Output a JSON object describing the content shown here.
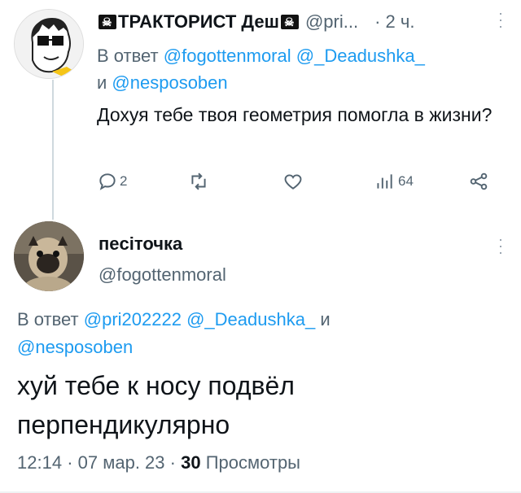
{
  "tweet1": {
    "display_name": "ТРАКТОРИСТ Деш",
    "handle": "@pri...",
    "separator": "·",
    "time": "2 ч.",
    "reply_prefix": "В ответ",
    "reply_mentions": [
      "@fogottenmoral",
      "@_Deadushka_",
      "@nesposoben"
    ],
    "reply_and": "и",
    "text": "Дохуя тебе твоя геометрия помогла в жизни?",
    "actions": {
      "replies": "2",
      "retweets": "",
      "likes": "",
      "views": "64"
    }
  },
  "tweet2": {
    "display_name": "пеciточка",
    "handle": "@fogottenmoral",
    "reply_prefix": "В ответ",
    "reply_mentions": [
      "@pri202222",
      "@_Deadushka_",
      "@nesposoben"
    ],
    "reply_and": "и",
    "text": "хуй тебе к носу подвёл перпендикулярно",
    "time": "12:14",
    "dot": "·",
    "date": "07 мар. 23",
    "views_count": "30",
    "views_label": "Просмотры"
  },
  "colors": {
    "link": "#1d9bf0",
    "secondary": "#536471",
    "primary": "#0f1419",
    "thread_line": "#cfd9de"
  }
}
